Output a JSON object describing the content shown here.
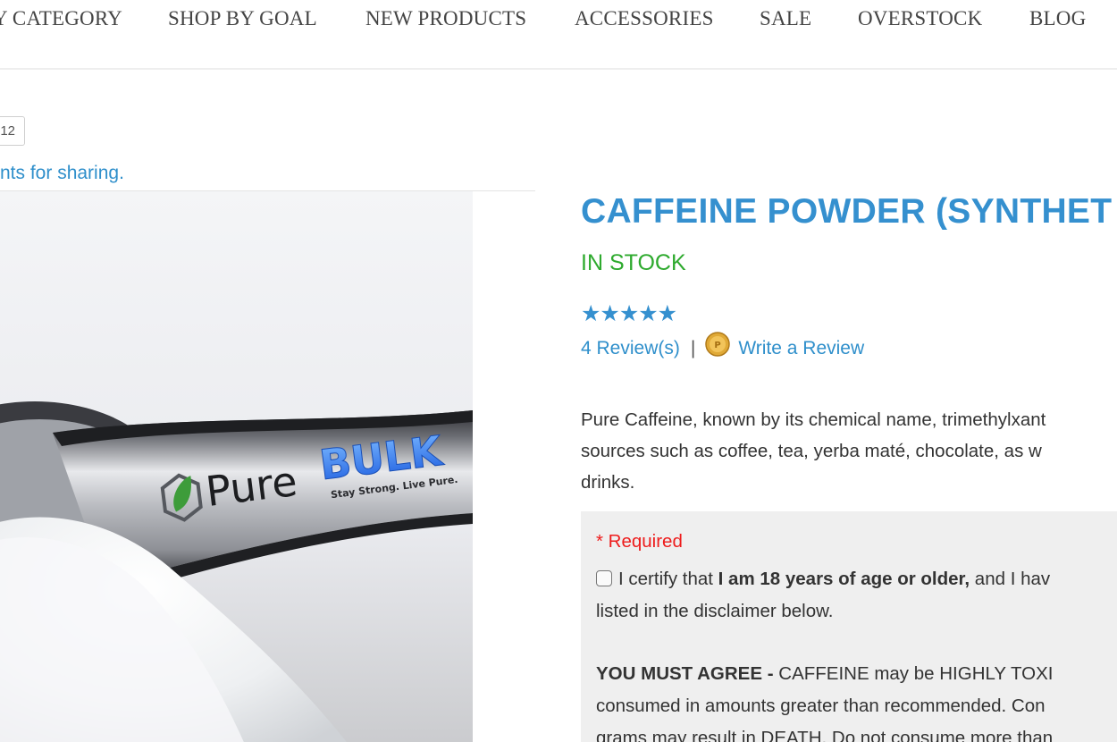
{
  "nav": {
    "items": [
      "Y CATEGORY",
      "SHOP BY GOAL",
      "NEW PRODUCTS",
      "ACCESSORIES",
      "SALE",
      "OVERSTOCK",
      "BLOG"
    ]
  },
  "share": {
    "count": "12",
    "text": "nts for sharing."
  },
  "image": {
    "brand_main": "Pure",
    "brand_bulk": "BULK",
    "tagline": "Stay Strong. Live Pure."
  },
  "product": {
    "title": "CAFFEINE POWDER (SYNTHET",
    "stock": "IN STOCK",
    "stars": "★★★★★",
    "rating": 5,
    "reviews_link": "4 Review(s)",
    "separator": "|",
    "write_review": "Write a Review",
    "description": [
      "Pure Caffeine, known by its chemical name, trimethylxant",
      "sources such as coffee, tea, yerba maté, chocolate, as w",
      "drinks."
    ]
  },
  "form": {
    "required": "* Required",
    "certify_pre": "I certify that ",
    "certify_bold": "I am 18 years of age or older,",
    "certify_post": " and I hav",
    "certify_line2": "listed in the disclaimer below.",
    "warning_bold": "YOU MUST AGREE -",
    "warning_line1": " CAFFEINE may be HIGHLY TOXI",
    "warning_line2": "consumed in amounts greater than recommended. Con",
    "warning_line3": "grams may result in DEATH. Do not consume more than"
  },
  "colors": {
    "accent": "#3590cf",
    "link": "#2f8fcb",
    "in_stock": "#2eaa2e",
    "required": "#ee1c1c",
    "panel_bg": "#efefef"
  }
}
